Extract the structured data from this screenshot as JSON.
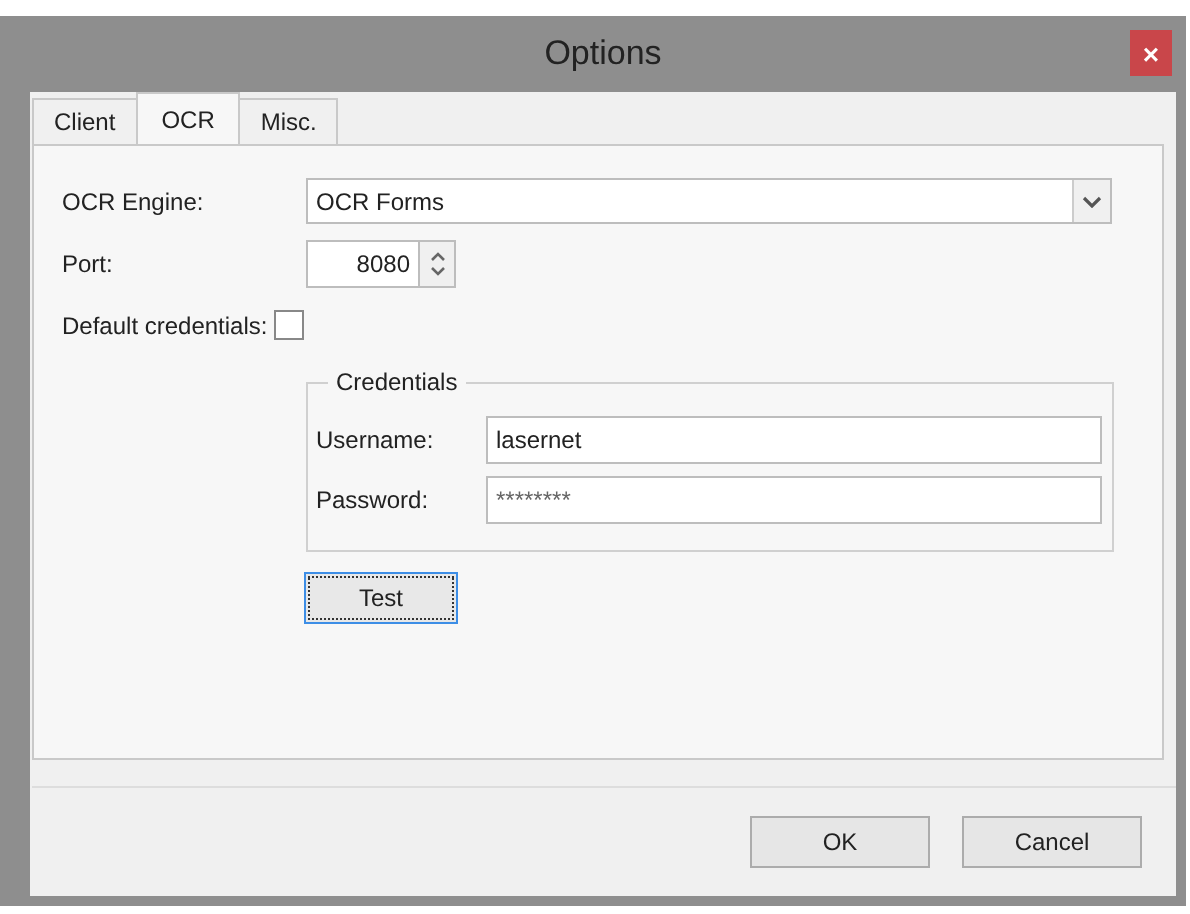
{
  "window": {
    "title": "Options",
    "close": "×"
  },
  "tabs": [
    {
      "label": "Client",
      "selected": false
    },
    {
      "label": "OCR",
      "selected": true
    },
    {
      "label": "Misc.",
      "selected": false
    }
  ],
  "ocr_engine": {
    "label": "OCR Engine:",
    "value": "OCR Forms"
  },
  "port": {
    "label": "Port:",
    "value": "8080"
  },
  "default_credentials": {
    "label": "Default credentials:",
    "checked": false
  },
  "credentials": {
    "title": "Credentials",
    "username": {
      "label": "Username:",
      "value": "lasernet"
    },
    "password": {
      "label": "Password:",
      "value": "********"
    }
  },
  "test_button": "Test",
  "buttons": [
    "OK",
    "Cancel"
  ]
}
